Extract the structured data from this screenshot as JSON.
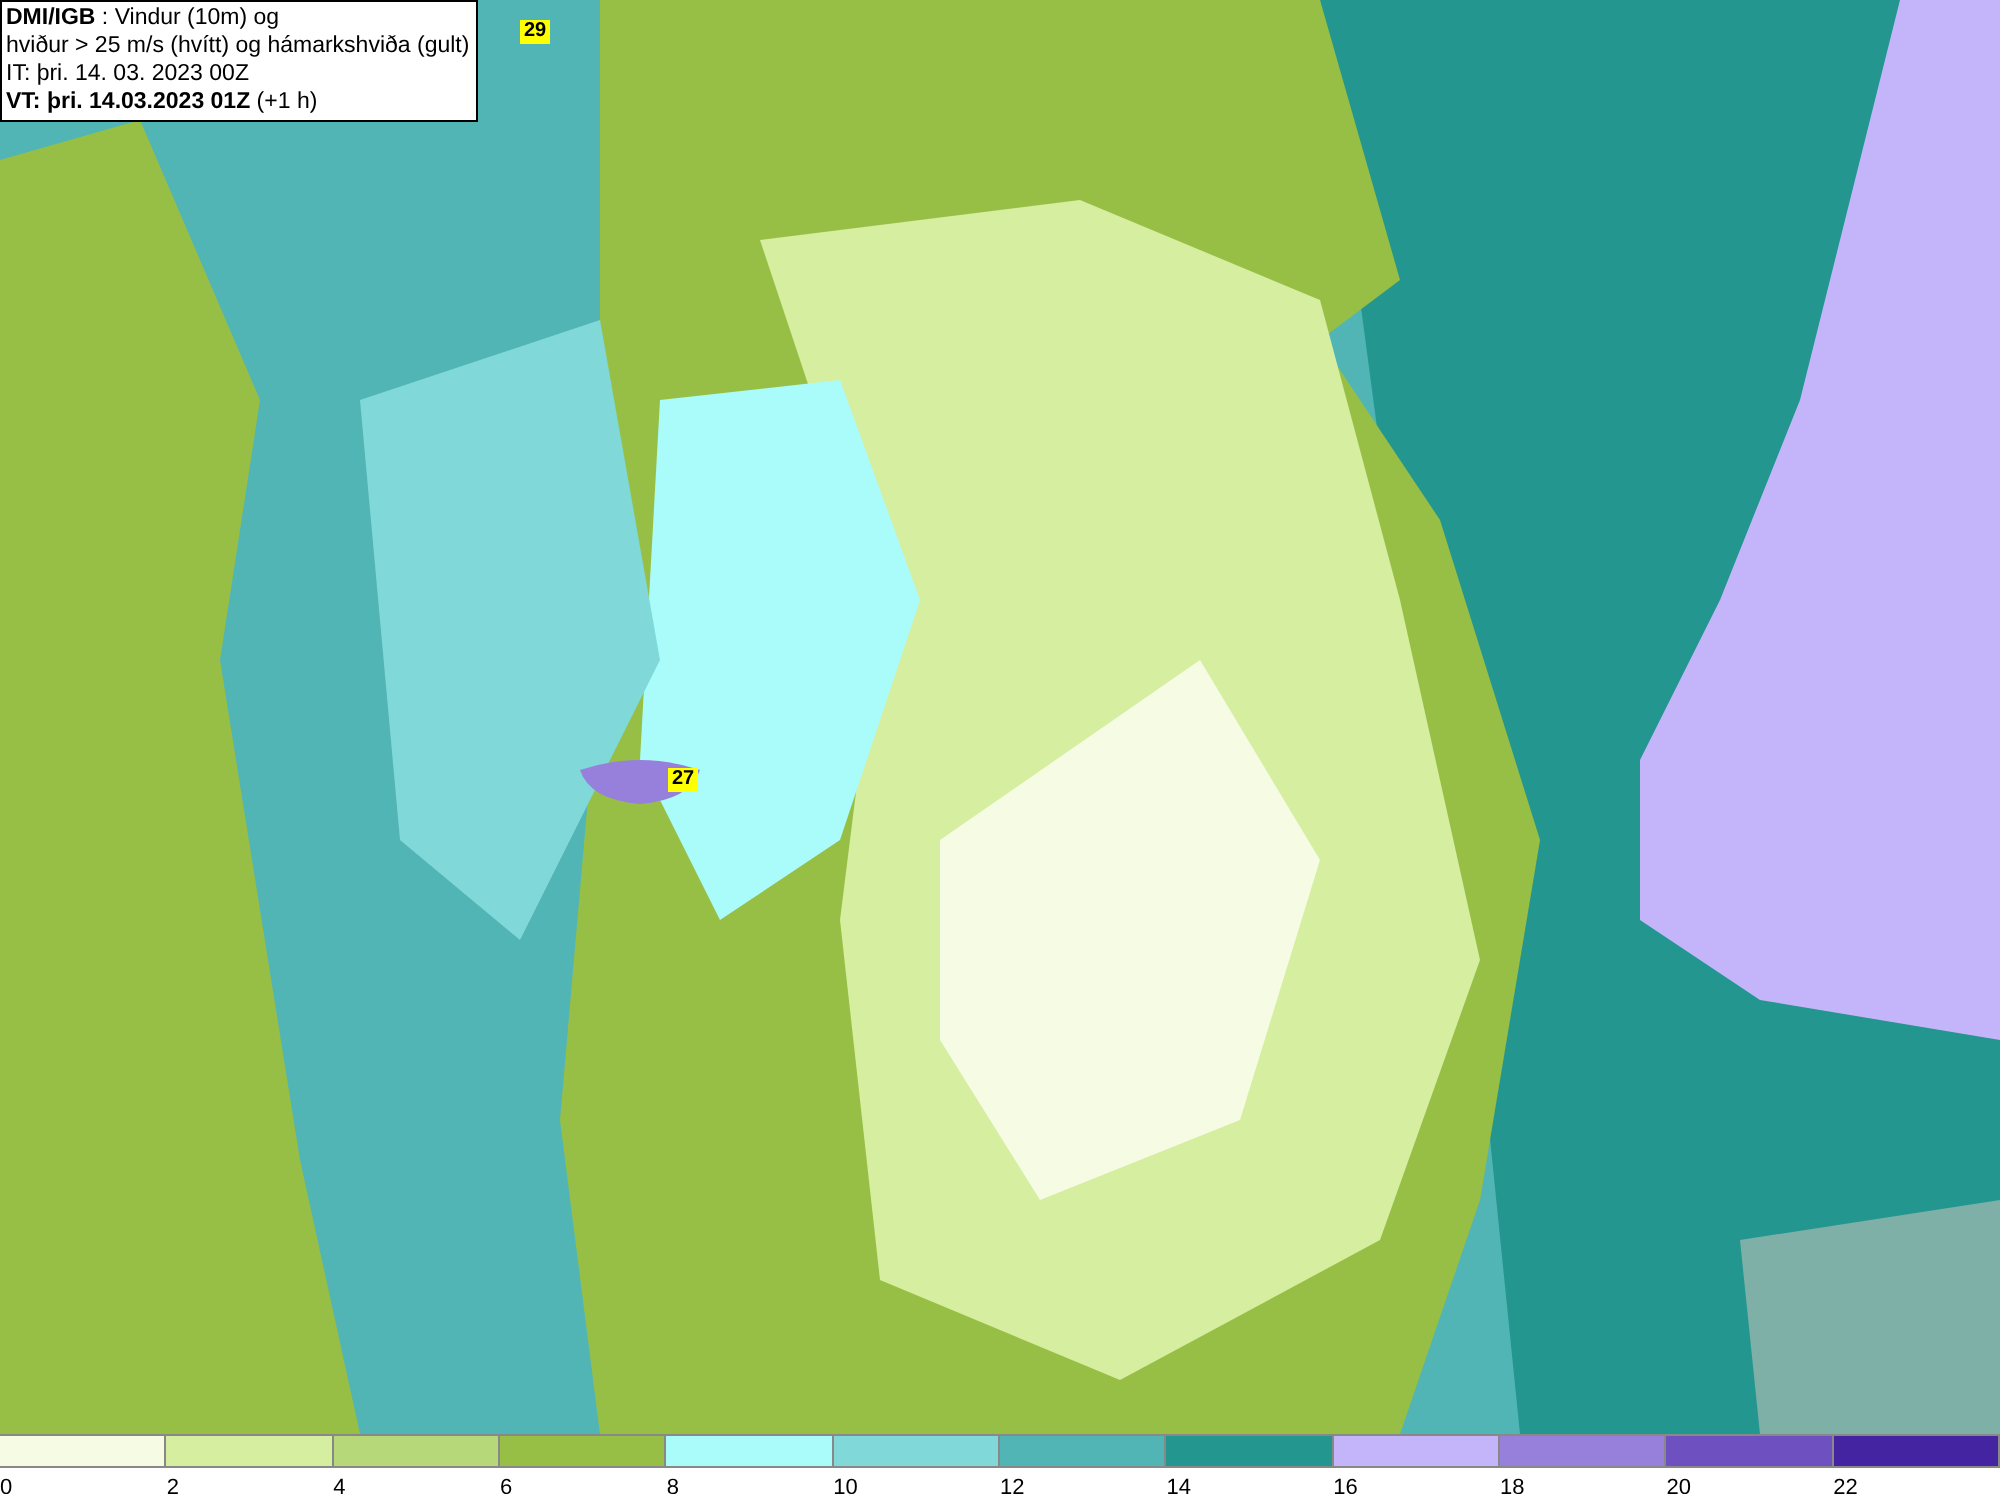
{
  "info_box": {
    "lines": [
      "**DMI/IGB** : Vindur (10m) og",
      "hviður > 25 m/s (hvítt) og hámarkshviða (gult)",
      "IT: þri. 14. 03. 2023 00Z",
      "**VT: þri. 14.03.2023 01Z** (+1 h)"
    ]
  },
  "map": {
    "gust_markers": [
      {
        "label": "29"
      },
      {
        "label": "27"
      }
    ]
  },
  "legend": {
    "segments": [
      {
        "color": "#f6fbe4",
        "label": "0"
      },
      {
        "color": "#d6eea0",
        "label": "2"
      },
      {
        "color": "#b6d878",
        "label": "4"
      },
      {
        "color": "#98bf45",
        "label": "6"
      },
      {
        "color": "#aafcfa",
        "label": "8"
      },
      {
        "color": "#80d8d8",
        "label": "10"
      },
      {
        "color": "#52b5b5",
        "label": "12"
      },
      {
        "color": "#249690",
        "label": "14"
      },
      {
        "color": "#c4b4fa",
        "label": "16"
      },
      {
        "color": "#9680dc",
        "label": "18"
      },
      {
        "color": "#6e50c0",
        "label": "20"
      },
      {
        "color": "#4424a0",
        "label": "22"
      }
    ]
  }
}
